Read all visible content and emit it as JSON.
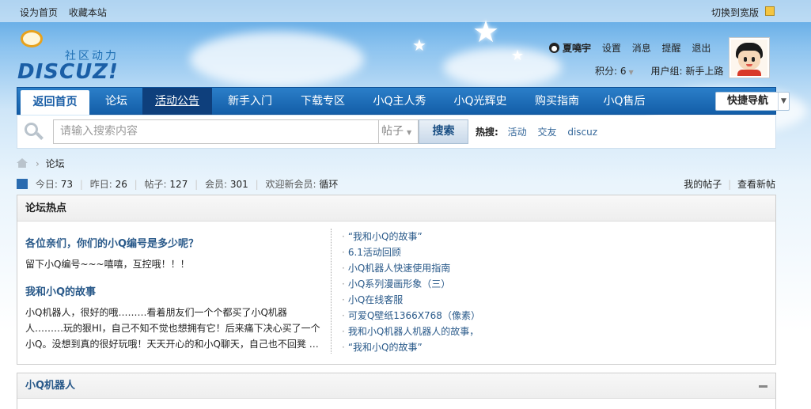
{
  "topbar": {
    "set_homepage": "设为首页",
    "bookmark": "收藏本站",
    "switch_wide": "切换到宽版"
  },
  "logo": {
    "slogan": "社区动力",
    "brand": "DISCUZ!"
  },
  "user": {
    "name": "夏嘵宇",
    "links": [
      "设置",
      "消息",
      "提醒",
      "退出"
    ],
    "points_label": "积分: 6",
    "group_label": "用户组: 新手上路"
  },
  "nav": {
    "items": [
      "返回首页",
      "论坛",
      "活动公告",
      "新手入门",
      "下载专区",
      "小Q主人秀",
      "小Q光辉史",
      "购买指南",
      "小Q售后"
    ],
    "quick_nav": "快捷导航"
  },
  "search": {
    "placeholder": "请输入搜索内容",
    "type": "帖子",
    "button": "搜索",
    "hot_label": "热搜:",
    "hot_keywords": [
      "活动",
      "交友",
      "discuz"
    ]
  },
  "breadcrumb": {
    "current": "论坛"
  },
  "stats": {
    "today_label": "今日:",
    "today": "73",
    "yesterday_label": "昨日:",
    "yesterday": "26",
    "posts_label": "帖子:",
    "posts": "127",
    "members_label": "会员:",
    "members": "301",
    "welcome_label": "欢迎新会员:",
    "new_member": "循环",
    "my_posts": "我的帖子",
    "view_new": "查看新帖"
  },
  "hot_panel": {
    "title": "论坛热点",
    "featured": [
      {
        "title": "各位亲们，你们的小Q编号是多少呢？",
        "desc": "留下小Q编号~~~嘻嘻，互控哦！！！"
      },
      {
        "title": "我和小Q的故事",
        "desc": "小Q机器人，很好的哦………看着朋友们一个个都买了小Q机器人………玩的狠HI，自己不知不觉也想拥有它！后来痛下决心买了一个小Q。没想到真的很好玩哦！天天开心的和小Q聊天，自己也不回凳 …"
      }
    ],
    "list": [
      "“我和小Q的故事”",
      "6.1活动回顾",
      "小Q机器人快速使用指南",
      "小Q系列漫画形象（三）",
      "小Q在线客服",
      "可爱Q壁纸1366X768（像素）",
      "我和小Q机器人机器人的故事，",
      "“我和小Q的故事”"
    ]
  },
  "category_panel": {
    "title": "小Q机器人"
  },
  "colors": {
    "nav_blue": "#135ea8",
    "link_blue": "#2a5a8a"
  }
}
